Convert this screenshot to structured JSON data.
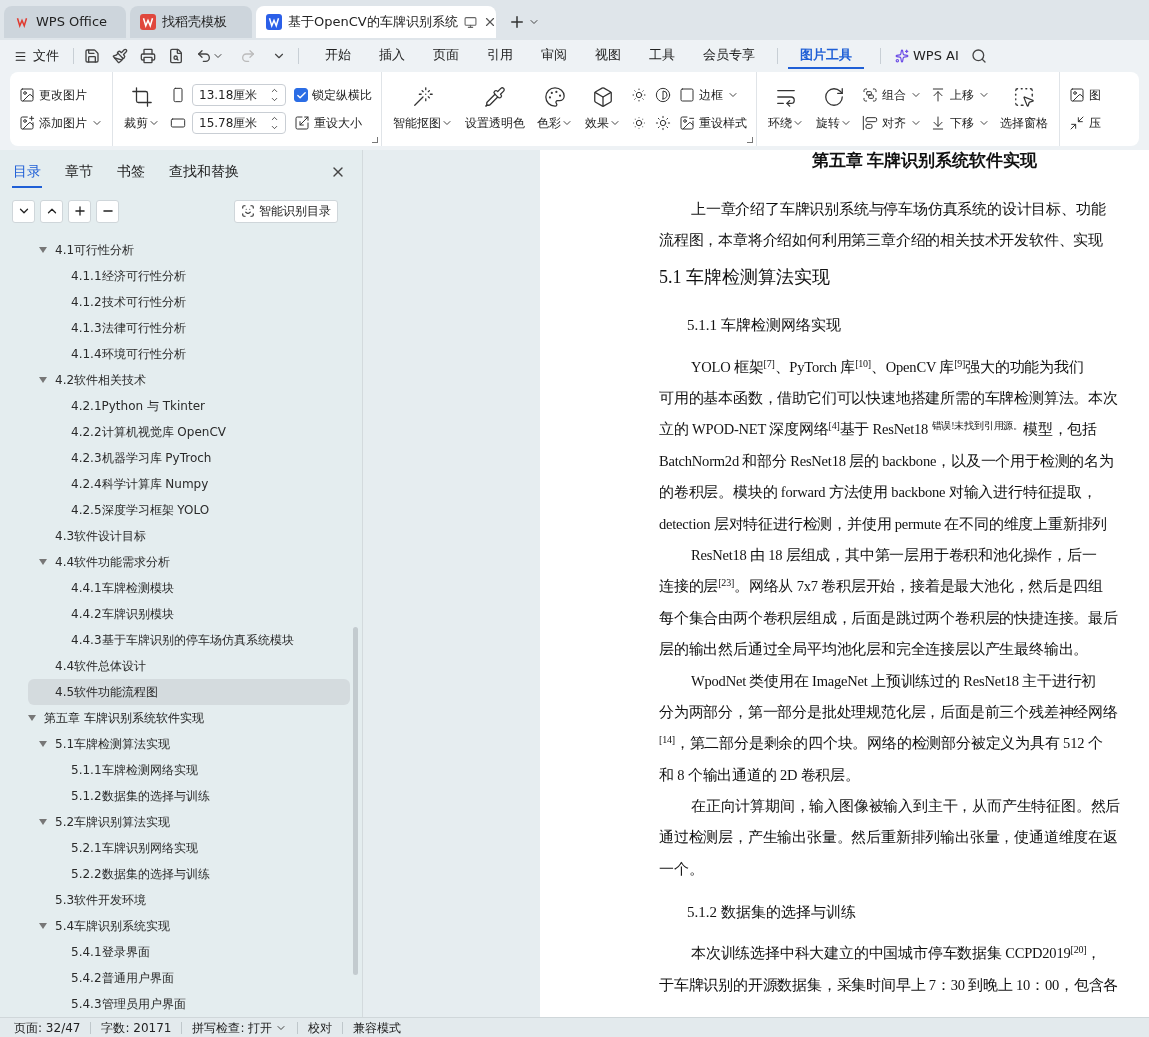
{
  "tab_bar": {
    "tabs": [
      {
        "label": "WPS Office",
        "selected": false
      },
      {
        "label": "找稻壳模板",
        "selected": false
      },
      {
        "label": "基于OpenCV的车牌识别系统",
        "selected": true
      }
    ]
  },
  "menu": {
    "file": "文件",
    "tabs": [
      {
        "label": "开始",
        "selected": false
      },
      {
        "label": "插入",
        "selected": false
      },
      {
        "label": "页面",
        "selected": false
      },
      {
        "label": "引用",
        "selected": false
      },
      {
        "label": "审阅",
        "selected": false
      },
      {
        "label": "视图",
        "selected": false
      },
      {
        "label": "工具",
        "selected": false
      },
      {
        "label": "会员专享",
        "selected": false
      },
      {
        "label": "图片工具",
        "selected": true
      }
    ],
    "ai": "WPS AI"
  },
  "ribbon": {
    "groups": [
      {
        "columns": [
          {
            "items": [
              {
                "kind": "small",
                "label": "更改图片"
              },
              {
                "kind": "small",
                "label": "添加图片",
                "dropdown": true
              }
            ]
          }
        ]
      },
      {
        "launcher": true,
        "columns": [
          {
            "items": [
              {
                "kind": "large",
                "label": "裁剪",
                "dropdown": true
              }
            ]
          },
          {
            "items": [
              {
                "kind": "field",
                "value": "13.18厘米"
              },
              {
                "kind": "field",
                "value": "15.78厘米"
              }
            ]
          },
          {
            "items": [
              {
                "kind": "checkbox",
                "label": "锁定纵横比",
                "checked": true
              },
              {
                "kind": "small",
                "label": "重设大小"
              }
            ]
          }
        ]
      },
      {
        "launcher": true,
        "columns": [
          {
            "items": [
              {
                "kind": "large",
                "label": "智能抠图",
                "dropdown": true
              }
            ]
          },
          {
            "items": [
              {
                "kind": "large",
                "label": "设置透明色"
              }
            ]
          },
          {
            "items": [
              {
                "kind": "large",
                "label": "色彩",
                "dropdown": true
              }
            ]
          },
          {
            "items": [
              {
                "kind": "large",
                "label": "效果",
                "dropdown": true
              }
            ]
          },
          {
            "items": [
              {
                "kind": "icon"
              },
              {
                "kind": "icon"
              }
            ]
          },
          {
            "items": [
              {
                "kind": "icon"
              },
              {
                "kind": "icon"
              }
            ]
          },
          {
            "items": [
              {
                "kind": "small",
                "label": "边框",
                "dropdown": true
              },
              {
                "kind": "small",
                "label": "重设样式"
              }
            ]
          }
        ]
      },
      {
        "columns": [
          {
            "items": [
              {
                "kind": "large",
                "label": "环绕",
                "dropdown": true
              }
            ]
          },
          {
            "items": [
              {
                "kind": "large",
                "label": "旋转",
                "dropdown": true
              }
            ]
          },
          {
            "items": [
              {
                "kind": "small",
                "label": "组合",
                "dropdown": true
              },
              {
                "kind": "small",
                "label": "对齐",
                "dropdown": true
              }
            ]
          },
          {
            "items": [
              {
                "kind": "small",
                "label": "上移",
                "dropdown": true
              },
              {
                "kind": "small",
                "label": "下移",
                "dropdown": true
              }
            ]
          },
          {
            "items": [
              {
                "kind": "large",
                "label": "选择窗格"
              }
            ]
          }
        ]
      },
      {
        "columns": [
          {
            "items": [
              {
                "kind": "small",
                "label": "图"
              },
              {
                "kind": "small",
                "label": "压"
              }
            ]
          }
        ]
      }
    ]
  },
  "sidebar": {
    "tabs": [
      {
        "label": "目录",
        "selected": true
      },
      {
        "label": "章节",
        "selected": false
      },
      {
        "label": "书签",
        "selected": false
      },
      {
        "label": "查找和替换",
        "selected": false
      }
    ],
    "smart_button": "智能识别目录",
    "tree": [
      {
        "kind": "section",
        "label": "4.1可行性分析",
        "selected": false,
        "expanded": true,
        "children": [
          {
            "kind": "section",
            "label": "4.1.1经济可行性分析",
            "selected": false
          },
          {
            "kind": "section",
            "label": "4.1.2技术可行性分析",
            "selected": false
          },
          {
            "kind": "section",
            "label": "4.1.3法律可行性分析",
            "selected": false
          },
          {
            "kind": "section",
            "label": "4.1.4环境可行性分析",
            "selected": false
          }
        ]
      },
      {
        "kind": "section",
        "label": "4.2软件相关技术",
        "selected": false,
        "expanded": true,
        "children": [
          {
            "kind": "section",
            "label": "4.2.1Python 与 Tkinter",
            "selected": false
          },
          {
            "kind": "section",
            "label": "4.2.2计算机视觉库 OpenCV",
            "selected": false
          },
          {
            "kind": "section",
            "label": "4.2.3机器学习库 PyTroch",
            "selected": false
          },
          {
            "kind": "section",
            "label": "4.2.4科学计算库 Numpy",
            "selected": false
          },
          {
            "kind": "section",
            "label": "4.2.5深度学习框架 YOLO",
            "selected": false
          }
        ]
      },
      {
        "kind": "section",
        "label": "4.3软件设计目标",
        "selected": false
      },
      {
        "kind": "section",
        "label": "4.4软件功能需求分析",
        "selected": false,
        "expanded": true,
        "children": [
          {
            "kind": "section",
            "label": "4.4.1车牌检测模块",
            "selected": false
          },
          {
            "kind": "section",
            "label": "4.4.2车牌识别模块",
            "selected": false
          },
          {
            "kind": "section",
            "label": "4.4.3基于车牌识别的停车场仿真系统模块",
            "selected": false
          }
        ]
      },
      {
        "kind": "section",
        "label": "4.4软件总体设计",
        "selected": false
      },
      {
        "kind": "section",
        "label": "4.5软件功能流程图",
        "selected": true
      },
      {
        "kind": "chapter",
        "label": "第五章 车牌识别系统软件实现",
        "selected": false,
        "expanded": true,
        "children": [
          {
            "kind": "section",
            "label": "5.1车牌检测算法实现",
            "selected": false,
            "expanded": true,
            "children": [
              {
                "kind": "section",
                "label": "5.1.1车牌检测网络实现",
                "selected": false
              },
              {
                "kind": "section",
                "label": "5.1.2数据集的选择与训练",
                "selected": false
              }
            ]
          },
          {
            "kind": "section",
            "label": "5.2车牌识别算法实现",
            "selected": false,
            "expanded": true,
            "children": [
              {
                "kind": "section",
                "label": "5.2.1车牌识别网络实现",
                "selected": false
              },
              {
                "kind": "section",
                "label": "5.2.2数据集的选择与训练",
                "selected": false
              }
            ]
          },
          {
            "kind": "section",
            "label": "5.3软件开发环境",
            "selected": false
          },
          {
            "kind": "section",
            "label": "5.4车牌识别系统实现",
            "selected": false,
            "expanded": true,
            "children": [
              {
                "kind": "section",
                "label": "5.4.1登录界面",
                "selected": false
              },
              {
                "kind": "section",
                "label": "5.4.2普通用户界面",
                "selected": false
              },
              {
                "kind": "section",
                "label": "5.4.3管理员用户界面",
                "selected": false
              }
            ]
          }
        ]
      }
    ]
  },
  "document": {
    "lines": [
      {
        "kind": "chapter_title",
        "text": "第五章 车牌识别系统软件实现"
      },
      {
        "kind": "body",
        "indent": true,
        "text": "上一章介绍了车牌识别系统与停车场仿真系统的设计目标、功能"
      },
      {
        "kind": "body",
        "text": "流程图，本章将介绍如何利用第三章介绍的相关技术开发软件、实现"
      },
      {
        "kind": "heading2",
        "text": "5.1 车牌检测算法实现"
      },
      {
        "kind": "heading3",
        "text": "5.1.1 车牌检测网络实现"
      },
      {
        "kind": "body",
        "indent": true,
        "text": "YOLO 框架$^{[7]}$、PyTorch 库$^{[10]}$、OpenCV 库$^{[9]}$强大的功能为我们"
      },
      {
        "kind": "body",
        "text": "可用的基本函数，借助它们可以快速地搭建所需的车牌检测算法。本次"
      },
      {
        "kind": "body",
        "text": "立的 WPOD-NET 深度网络$^{[4]}$基于 ResNet18 $^{错误!未找到引用源。}$模型，包括"
      },
      {
        "kind": "body",
        "text": "BatchNorm2d 和部分 ResNet18 层的 backbone，以及一个用于检测的名为"
      },
      {
        "kind": "body",
        "text": "的卷积层。模块的 forward 方法使用 backbone 对输入进行特征提取，"
      },
      {
        "kind": "body",
        "text": "detection 层对特征进行检测，并使用 permute 在不同的维度上重新排列"
      },
      {
        "kind": "body",
        "indent": true,
        "text": "ResNet18 由 18 层组成，其中第一层用于卷积和池化操作，后一"
      },
      {
        "kind": "body",
        "text": "连接的层$^{[23]}$。网络从 7x7 卷积层开始，接着是最大池化，然后是四组"
      },
      {
        "kind": "body",
        "text": "每个集合由两个卷积层组成，后面是跳过两个卷积层的快捷连接。最后"
      },
      {
        "kind": "body",
        "text": "层的输出然后通过全局平均池化层和完全连接层以产生最终输出。"
      },
      {
        "kind": "body",
        "indent": true,
        "text": "WpodNet 类使用在 ImageNet 上预训练过的 ResNet18 主干进行初"
      },
      {
        "kind": "body",
        "text": "分为两部分，第一部分是批处理规范化层，后面是前三个残差神经网络"
      },
      {
        "kind": "body",
        "text": "$^{[14]}$，第二部分是剩余的四个块。网络的检测部分被定义为具有 512 个"
      },
      {
        "kind": "body",
        "text": "和 8 个输出通道的 2D 卷积层。"
      },
      {
        "kind": "body",
        "indent": true,
        "text": "在正向计算期间，输入图像被输入到主干，从而产生特征图。然后"
      },
      {
        "kind": "body",
        "text": "通过检测层，产生输出张量。然后重新排列输出张量，使通道维度在返"
      },
      {
        "kind": "body",
        "text": "一个。"
      },
      {
        "kind": "heading3",
        "text": "5.1.2 数据集的选择与训练"
      },
      {
        "kind": "body",
        "indent": true,
        "text": "本次训练选择中科大建立的中国城市停车数据集 CCPD2019$^{[20]}$，"
      },
      {
        "kind": "body",
        "text": "于车牌识别的开源数据集，采集时间早上 7：30 到晚上 10：00，包含各"
      }
    ]
  },
  "status_bar": [
    {
      "text": "页面: 32/47"
    },
    {
      "text": "字数: 20171"
    },
    {
      "text": "拼写检查: 打开",
      "dropdown": true
    },
    {
      "text": "校对"
    },
    {
      "text": "兼容模式"
    }
  ]
}
